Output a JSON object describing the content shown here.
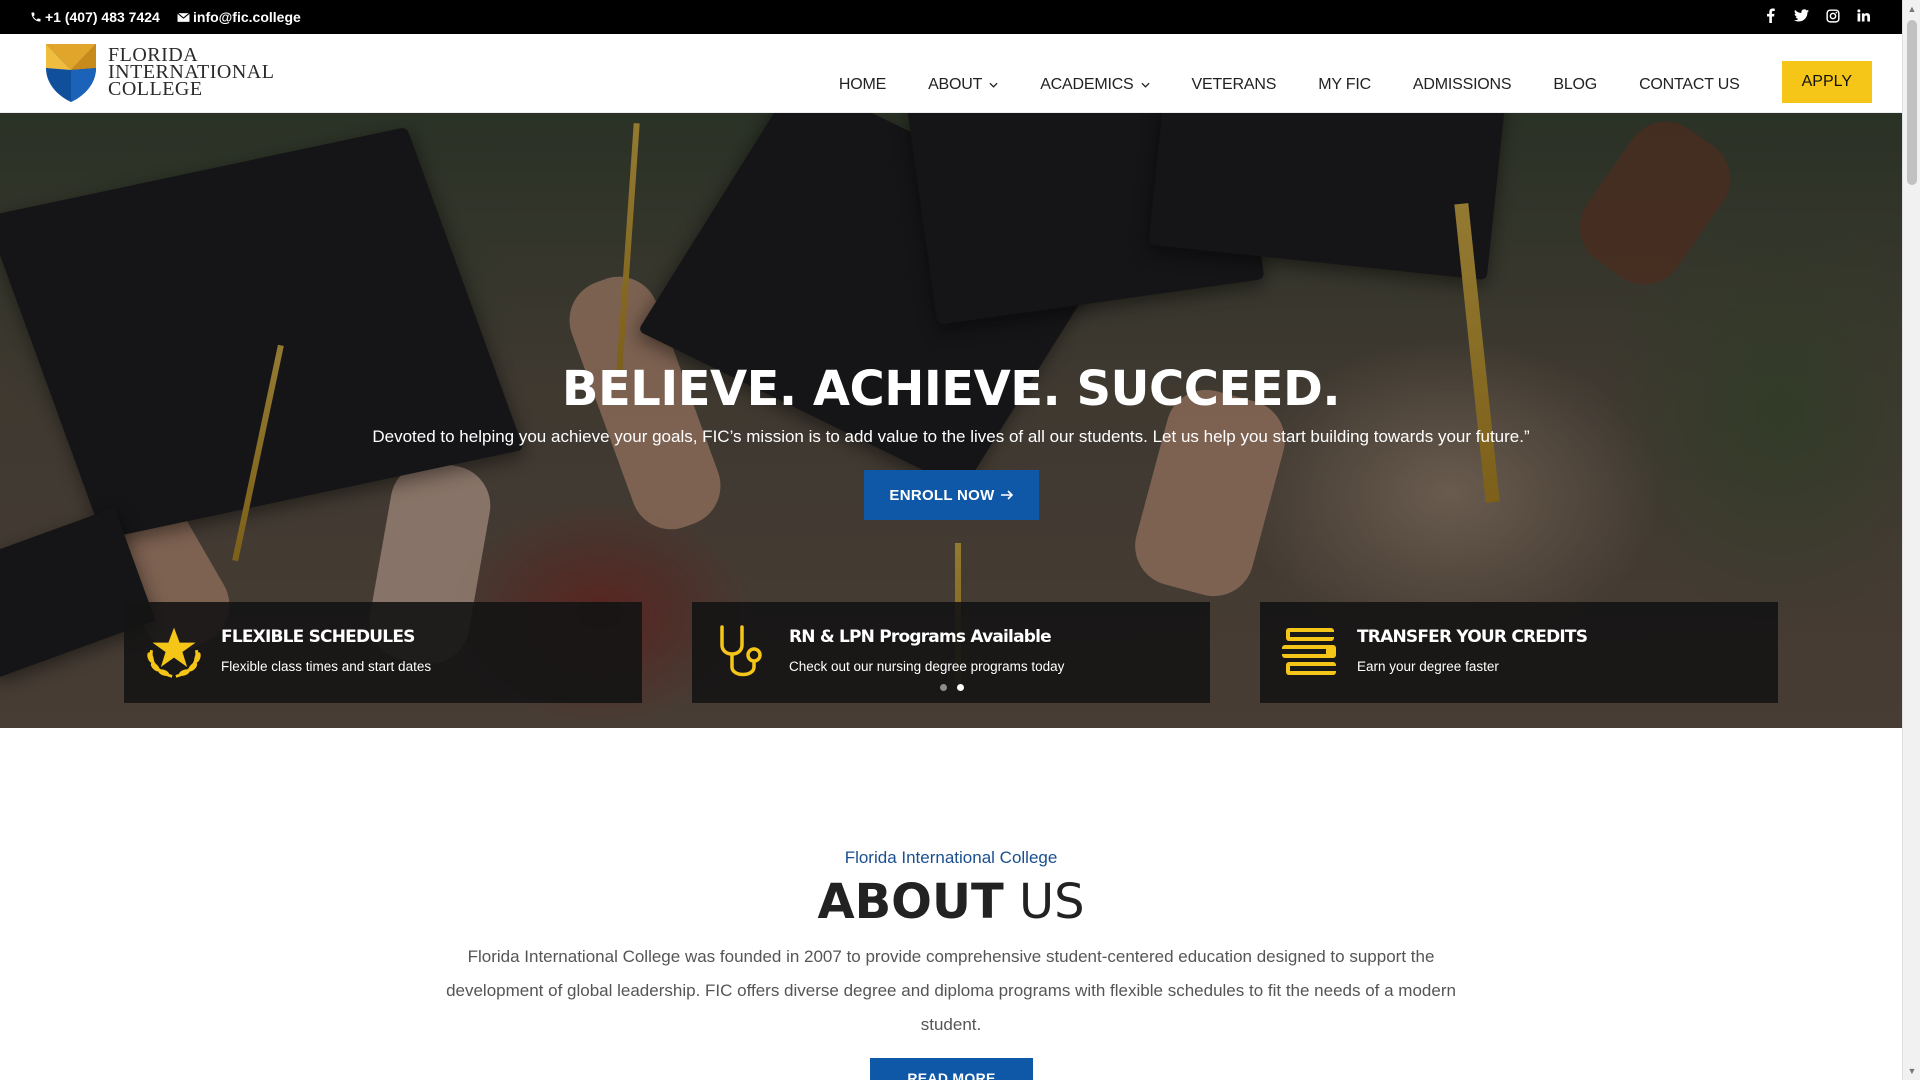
{
  "topbar": {
    "phone": "+1 (407) 483 7424",
    "email": "info@fic.college",
    "social": [
      "facebook-icon",
      "twitter-icon",
      "instagram-icon",
      "linkedin-icon"
    ]
  },
  "logo": {
    "line1": "FLORIDA",
    "line2": "INTERNATIONAL",
    "line3": "COLLEGE"
  },
  "nav": {
    "items": [
      {
        "label": "HOME"
      },
      {
        "label": "ABOUT"
      },
      {
        "label": "ACADEMICS"
      },
      {
        "label": "VETERANS"
      },
      {
        "label": "MY FIC"
      },
      {
        "label": "ADMISSIONS"
      },
      {
        "label": "BLOG"
      },
      {
        "label": "CONTACT US"
      }
    ],
    "apply_label": "APPLY"
  },
  "hero": {
    "title": "BELIEVE. ACHIEVE. SUCCEED.",
    "subtitle": "Devoted to helping you achieve your goals, FIC’s mission is to add value to the lives of all our students. Let us help you start building towards your future.”",
    "enroll_label": "ENROLL NOW",
    "features": [
      {
        "title": "FLEXIBLE SCHEDULES",
        "desc": "Flexible class times and start dates",
        "icon": "star-laurel-icon"
      },
      {
        "title": "RN & LPN Programs Available",
        "desc": "Check out our nursing degree programs today",
        "icon": "stethoscope-icon"
      },
      {
        "title": "TRANSFER YOUR CREDITS",
        "desc": "Earn your degree faster",
        "icon": "books-icon"
      }
    ]
  },
  "about": {
    "kicker": "Florida International College",
    "title_bold": "ABOUT",
    "title_light": " US",
    "text": "Florida International College was founded in 2007 to provide comprehensive student-centered education designed to support the development of global leadership. FIC offers diverse degree and diploma programs with flexible schedules to fit the needs of a modern student.",
    "readmore_label": "READ MORE"
  },
  "colors": {
    "accent_yellow": "#f5c518",
    "brand_blue": "#0f58a8",
    "kicker_blue": "#1a4f8f"
  }
}
